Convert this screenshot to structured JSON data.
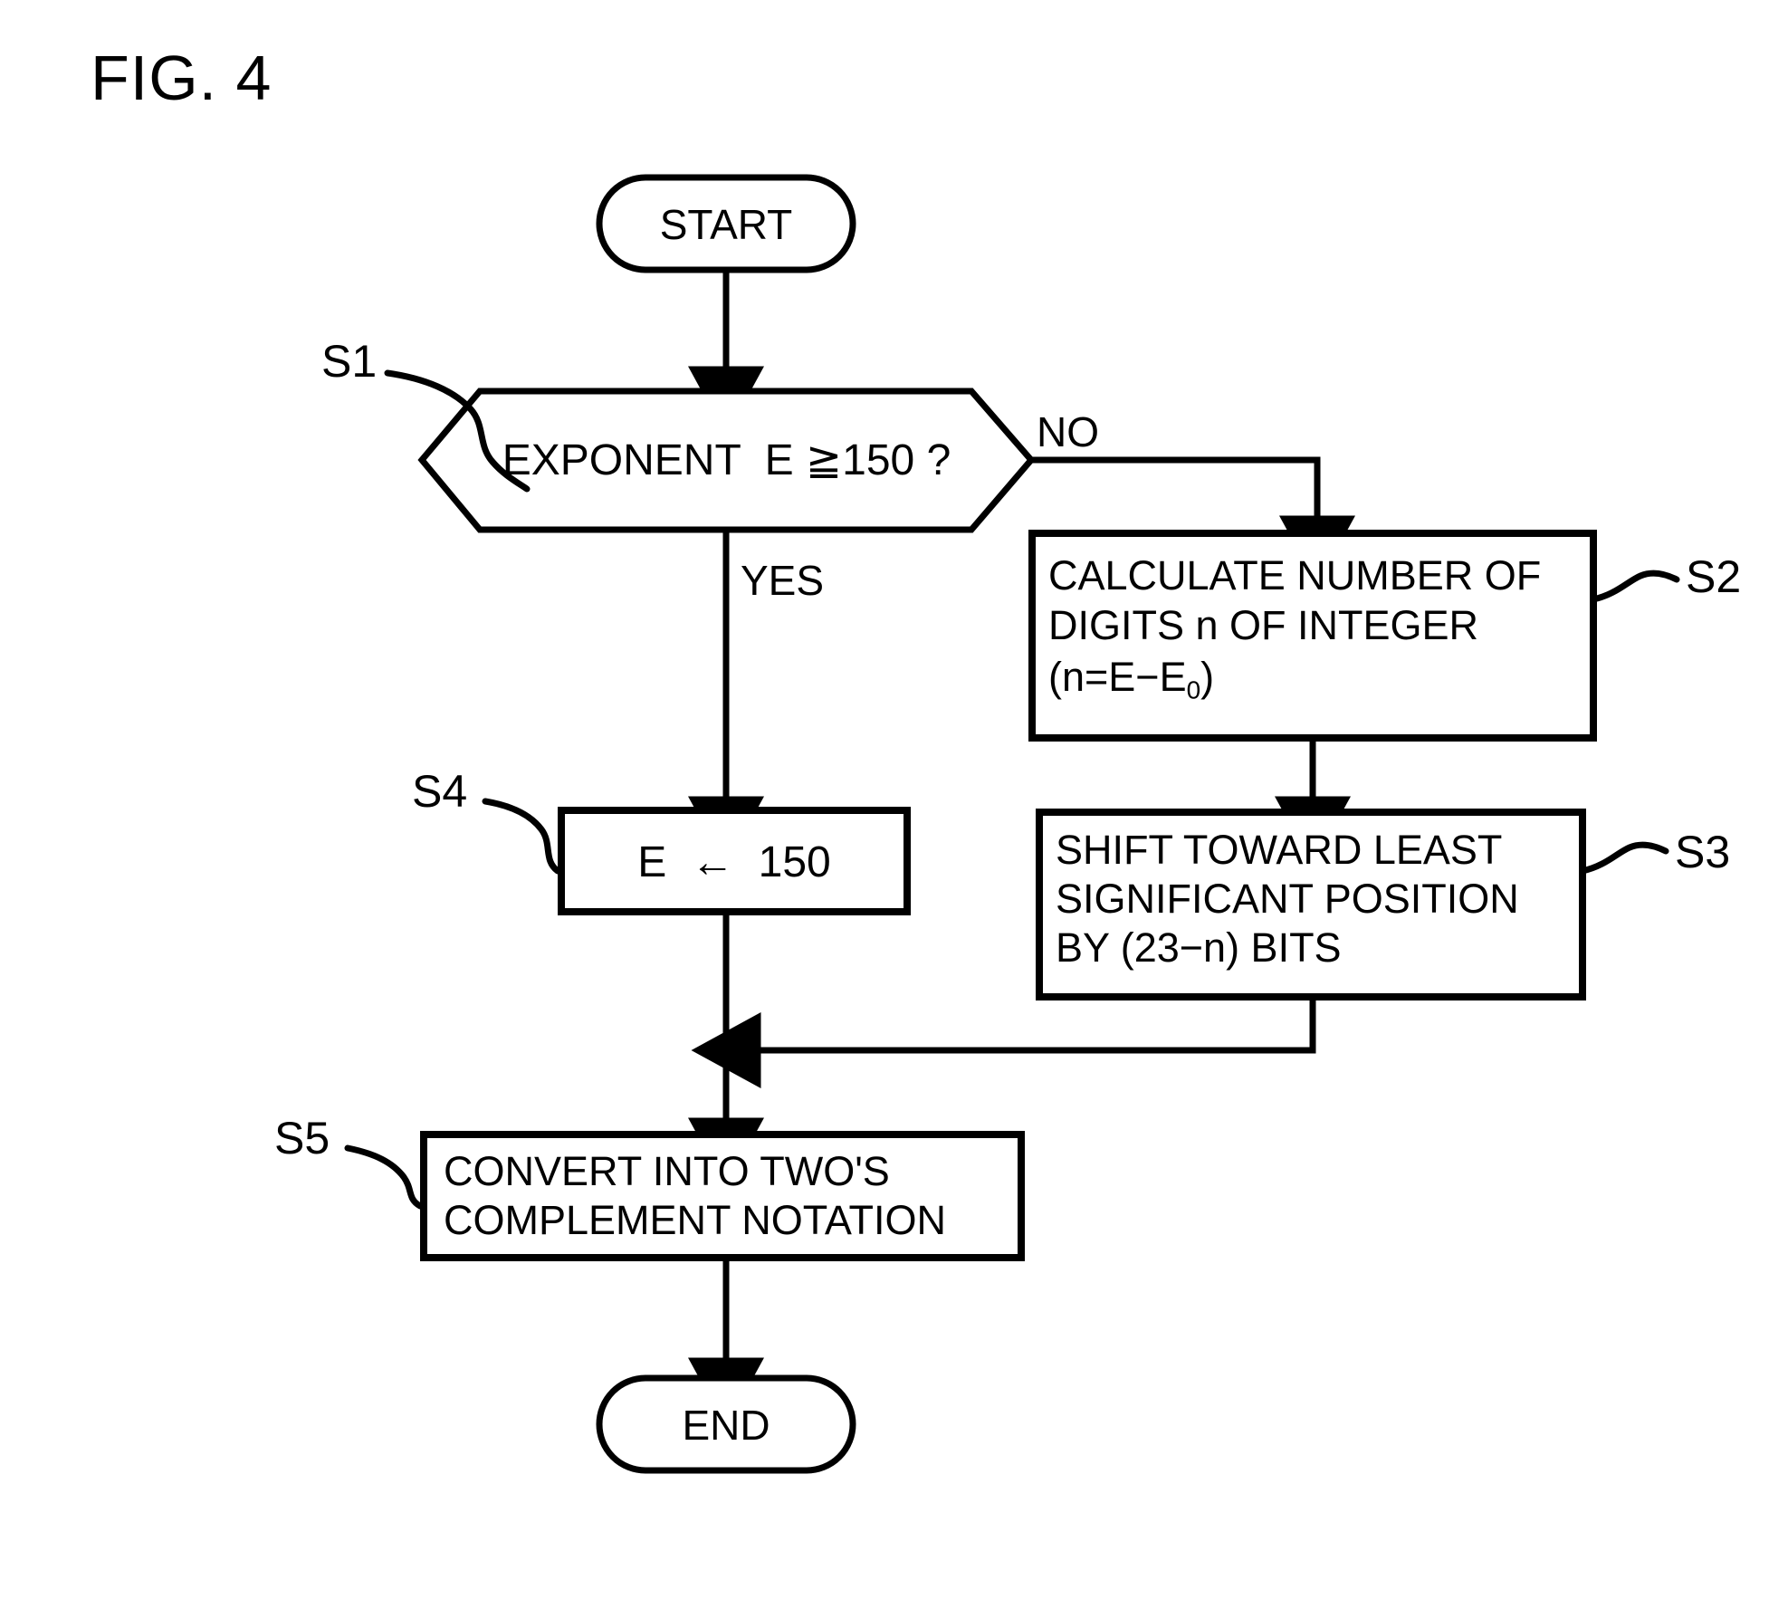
{
  "figure": {
    "title": "FIG. 4",
    "type": "flowchart"
  },
  "nodes": {
    "start": {
      "label": "START",
      "shape": "terminator"
    },
    "decision_s1": {
      "step": "S1",
      "text": "EXPONENT  E ≧150 ?",
      "shape": "hexagon-decision"
    },
    "process_s2": {
      "step": "S2",
      "line1": "CALCULATE NUMBER OF",
      "line2": "DIGITS n OF INTEGER",
      "line3_pre": "(n=E−E",
      "line3_sub": "0",
      "line3_post": ")",
      "shape": "rectangle"
    },
    "process_s3": {
      "step": "S3",
      "line1": "SHIFT TOWARD LEAST",
      "line2": "SIGNIFICANT POSITION",
      "line3": "BY (23−n) BITS",
      "shape": "rectangle"
    },
    "process_s4": {
      "step": "S4",
      "text": "E  ←  150",
      "shape": "rectangle"
    },
    "process_s5": {
      "step": "S5",
      "line1": "CONVERT INTO TWO'S",
      "line2": "COMPLEMENT NOTATION",
      "shape": "rectangle"
    },
    "end": {
      "label": "END",
      "shape": "terminator"
    }
  },
  "edge_labels": {
    "yes": "YES",
    "no": "NO"
  },
  "colors": {
    "stroke": "#000000",
    "background": "#ffffff"
  }
}
